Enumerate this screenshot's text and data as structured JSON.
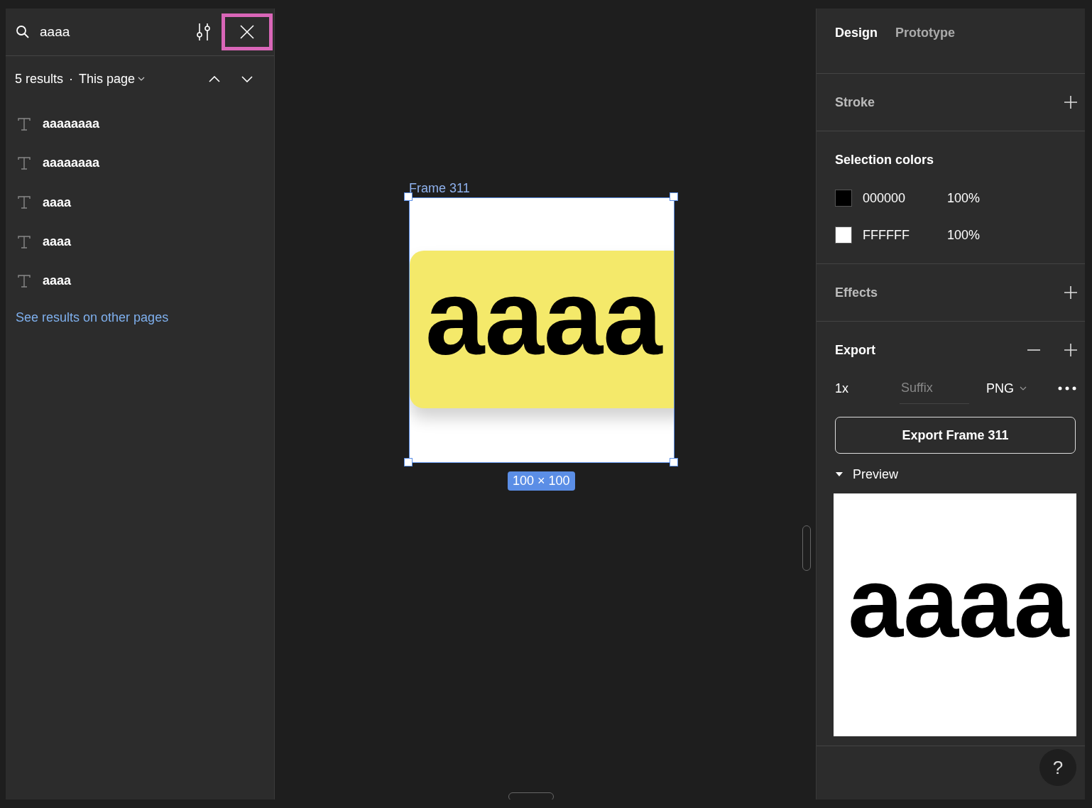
{
  "find_panel": {
    "search": {
      "value": "aaaa"
    },
    "close_button": {
      "highlighted": true
    },
    "summary": {
      "count": "5 results",
      "separator": "·",
      "scope": "This page"
    },
    "results": [
      {
        "text": "aaaaaaaa"
      },
      {
        "text": "aaaaaaaa"
      },
      {
        "text": "aaaa"
      },
      {
        "text": "aaaa"
      },
      {
        "text": "aaaa"
      }
    ],
    "other_pages_link": "See results on other pages"
  },
  "canvas": {
    "frame": {
      "name": "Frame 311",
      "artwork_text": "aaaa",
      "size": "100 × 100"
    }
  },
  "design_panel": {
    "tabs": [
      {
        "label": "Design",
        "selected": true
      },
      {
        "label": "Prototype",
        "selected": false
      }
    ],
    "stroke": {
      "title": "Stroke"
    },
    "selection_colors": {
      "title": "Selection colors",
      "colors": [
        {
          "hex": "000000",
          "opacity": "100%",
          "color": "#000000"
        },
        {
          "hex": "FFFFFF",
          "opacity": "100%",
          "color": "#ffffff"
        }
      ]
    },
    "effects": {
      "title": "Effects"
    },
    "export": {
      "title": "Export",
      "scale": "1x",
      "suffix_placeholder": "Suffix",
      "format": "PNG",
      "button": "Export Frame 311",
      "preview": {
        "label": "Preview",
        "expanded": true,
        "artwork_text": "aaaa"
      }
    },
    "help": "?"
  }
}
